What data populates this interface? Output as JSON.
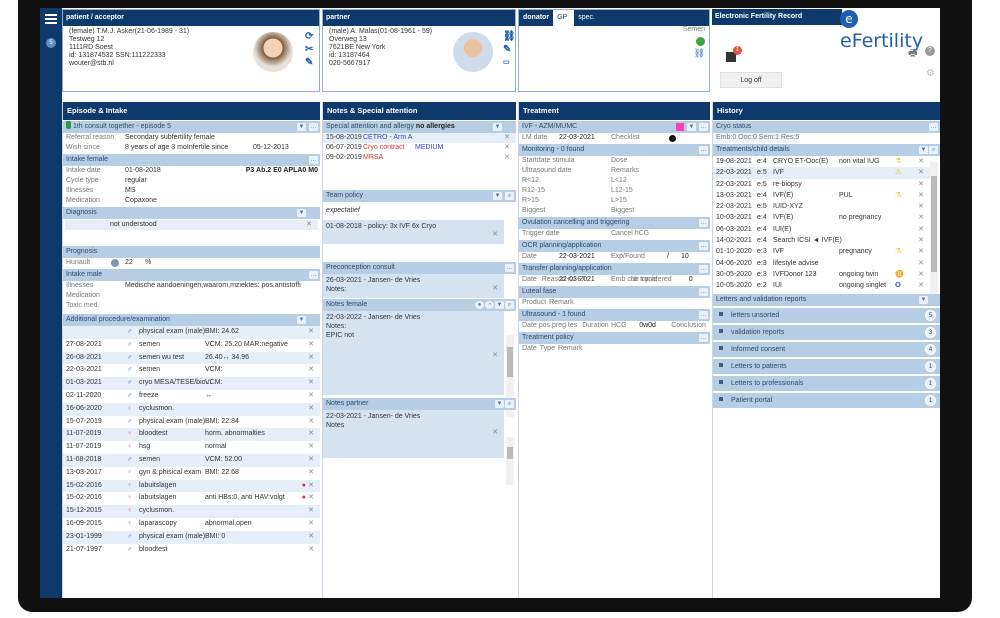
{
  "header": {
    "patient_title": "patient / acceptor",
    "patient_lines": [
      "(female) T.M.J. Asker(21-06-1989 - 31)",
      "Testweg 12",
      "1111RD Soest",
      "id: 131874532 SSN:111222333",
      "wouter@stb.nl"
    ],
    "partner_title": "partner",
    "partner_lines": [
      "(male) A. Malas(01-08-1961 - 59)",
      "Overweg 13",
      "7621BE New York",
      "id: 13187464",
      "020-5667917"
    ],
    "donor_tabs": [
      "donator",
      "GP",
      "spec."
    ],
    "donor_text": "Semen",
    "efr_title": "Electronic Fertility Record",
    "logo": "eFertility",
    "logoff": "Log off",
    "notif_count": "1",
    "sidebar_badge": "5"
  },
  "col1": {
    "title": "Episode & Intake",
    "episode": "1th consult together - episode 5",
    "referral_label": "Referral reason",
    "referral": "Secondary subfertility female",
    "wish_label": "Wish since",
    "wish": "8 years of age 3 moInfertile since",
    "wish_date": "05-12-2013",
    "intake_female": "Intake female",
    "intake_rows": [
      [
        "Intake date",
        "01-08-2018"
      ],
      [
        "Cycle type",
        "regular"
      ],
      [
        "Illnesses",
        "MS"
      ],
      [
        "Medication",
        "Copaxone"
      ]
    ],
    "obstetric": "P3 Ab.2 E0 APLA0 M0",
    "diagnosis": "Diagnosis",
    "diagnosis_value": "not understood",
    "prognosis": "Prognosis",
    "hunault_label": "Hunault",
    "hunault": "22",
    "hunault_unit": "%",
    "intake_male": "Intake male",
    "male_rows": [
      [
        "Illnesses",
        "Medische aandoeningen,waarom,mziektes: pos.antistoffi"
      ],
      [
        "Medication",
        ""
      ],
      [
        "Toxic med.",
        ""
      ]
    ],
    "procedures_title": "Additional procedure/examination",
    "procedures": [
      [
        "",
        "m",
        "physical exam (male)",
        "BMI: 24.62"
      ],
      [
        "27-08-2021",
        "m",
        "semen",
        "VCM: 25.20 MAR:negative"
      ],
      [
        "26-08-2021",
        "m",
        "semen wu test",
        "26.40↔ 34.96"
      ],
      [
        "22-03-2021",
        "m",
        "semen",
        "VCM:"
      ],
      [
        "01-03-2021",
        "m",
        "cryo MESA/TESE/bio...",
        "VCM:"
      ],
      [
        "02-11-2020",
        "m",
        "freeze",
        "↔"
      ],
      [
        "16-06-2020",
        "f",
        "cyclusmon.",
        ""
      ],
      [
        "15-07-2019",
        "m",
        "physical exam (male)",
        "BMI: 22.84"
      ],
      [
        "11-07-2019",
        "f",
        "bloodtest",
        "horm. abnormalties"
      ],
      [
        "11-07-2019",
        "f",
        "hsg",
        "normal"
      ],
      [
        "11-08-2018",
        "m",
        "semen",
        "VCM: 52.00"
      ],
      [
        "13-03-2017",
        "f",
        "gyn & phisical exam",
        "BMI: 22.68"
      ],
      [
        "15-02-2016",
        "f",
        "labuitslagen",
        ""
      ],
      [
        "15-02-2016",
        "f",
        "labuitslagen",
        "anti HBs:0, anti HAV:volgt"
      ],
      [
        "15-12-2015",
        "f",
        "cyclusmon.",
        ""
      ],
      [
        "16-09-2015",
        "f",
        "laparascopy",
        "abnormal,open"
      ],
      [
        "23-01-1999",
        "m",
        "physical exam (male)",
        "BMI: 0"
      ],
      [
        "21-07-1997",
        "m",
        "bloodtest",
        ""
      ]
    ]
  },
  "col2": {
    "title": "Notes & Special attention",
    "allergy_label": "Special attention and allergy",
    "allergy_value": "no allergies",
    "attention": [
      [
        "15-08-2019",
        "CETRO - Arm A",
        ""
      ],
      [
        "06-07-2019",
        "Cryo contract",
        "MEDIUM"
      ],
      [
        "09-02-2019",
        "MRSA",
        ""
      ]
    ],
    "team_policy": "Team policy",
    "team_policy_text": "expectatief",
    "team_policy_note": "01-08-2018 - policy: 3x IVF 6x Cryo",
    "preconception": "Preconception consult",
    "preconception_note": [
      "26-03-2021 - Jansen- de Vries",
      "Notes:"
    ],
    "notes_female": "Notes female",
    "notes_female_note": [
      "22-03-2022 - Jansen- de Vries",
      "Notes:",
      "EPIC not"
    ],
    "notes_partner": "Notes partner",
    "notes_partner_note": [
      "22-03-2021 - Jansen- de Vries",
      "Notes"
    ]
  },
  "col3": {
    "title": "Treatment",
    "ivf": "IVF - AZM/MUMC",
    "lm_label": "LM date",
    "lm_date": "22-03-2021",
    "checklist": "Checklist",
    "monitoring": "Monitoring - 0 found",
    "monitoring_rows": [
      [
        "Startdate stimula",
        "Dose"
      ],
      [
        "Ultrasound date",
        "Remarks"
      ],
      [
        "R<12",
        "L<12"
      ],
      [
        "R12-15",
        "L12-15"
      ],
      [
        "R>15",
        "L>15"
      ],
      [
        "Biggest",
        "Biggest"
      ]
    ],
    "ovulation": "Ovulation cancelling and triggering",
    "trigger": "Trigger date",
    "cancel": "Cancel hCG",
    "ocr": "OCR planning/application",
    "ocr_date_label": "Date",
    "ocr_date": "22-03-2021",
    "exp_found": "Exp/Found",
    "exp_value": "/",
    "found_value": "10",
    "transfer": "Transfer planning/application",
    "tr_date_label": "Date",
    "tr_date": "22-03-2021",
    "emb": "Emb curr cycle",
    "reason": "Reason no ET",
    "nr_transfered": "Nr transfered",
    "nr_value": "0",
    "luteal": "Luteal fase",
    "luteal_rows": [
      "Product",
      "Remark"
    ],
    "ultrasound": "Ultrasound - 1 found",
    "pos_preg": "Date pos preg tes",
    "hcg": "HCG",
    "duration": "Duration",
    "duration_value": "0w0d",
    "conclusion": "Conclusion",
    "policy": "Treatment policy",
    "policy_rows": [
      "Date",
      "Type",
      "Remark"
    ]
  },
  "col4": {
    "title": "History",
    "cryo": "Cryo status",
    "cryo_value": "Emb:0 Ooc:0 Sem:1 Res:5",
    "treatments": "Treatments/child details",
    "history": [
      [
        "19-08-2021",
        "e:4",
        "CRYO ET-Ooc(E)",
        "non vital IUG",
        "flask"
      ],
      [
        "22-03-2021",
        "e:5",
        "IVF",
        "",
        "warning"
      ],
      [
        "22-03-2021",
        "e:5",
        "re-biopsy",
        "",
        ""
      ],
      [
        "13-03-2021",
        "e:4",
        "IVF(E)",
        "PUL",
        "flask"
      ],
      [
        "22-03-2021",
        "e:5",
        "IUID-XYZ",
        "",
        ""
      ],
      [
        "10-03-2021",
        "e:4",
        "IVF(E)",
        "no pregnancy",
        ""
      ],
      [
        "06-03-2021",
        "e:4",
        "IUI(E)",
        "",
        ""
      ],
      [
        "14-02-2021",
        "e:4",
        "Search ICSI ◄ IVF(E)",
        "",
        ""
      ],
      [
        "01-10-2020",
        "e:3",
        "IVF",
        "pregnancy",
        "flask"
      ],
      [
        "04-06-2020",
        "e:3",
        "lifestyle advise",
        "",
        ""
      ],
      [
        "30-05-2020",
        "e:3",
        "IVFDonor 123",
        "ongoing twin",
        "twin"
      ],
      [
        "10-05-2020",
        "e:2",
        "IUI",
        "ongoing singlet",
        "baby"
      ]
    ],
    "letters_title": "Letters and validation reports",
    "letters": [
      [
        "letters unsorted",
        "5"
      ],
      [
        "validation reports",
        "3"
      ],
      [
        "Informed consent",
        "4"
      ],
      [
        "Letters to patients",
        "1"
      ],
      [
        "Letters to professionals",
        "1"
      ],
      [
        "Patient portal",
        "1"
      ]
    ]
  },
  "colors": {
    "navy": "#0d3a6b",
    "section": "#b7cde4",
    "male": "#1f5fb0",
    "female": "#d36fc1",
    "accent": "#ff3fb4"
  }
}
